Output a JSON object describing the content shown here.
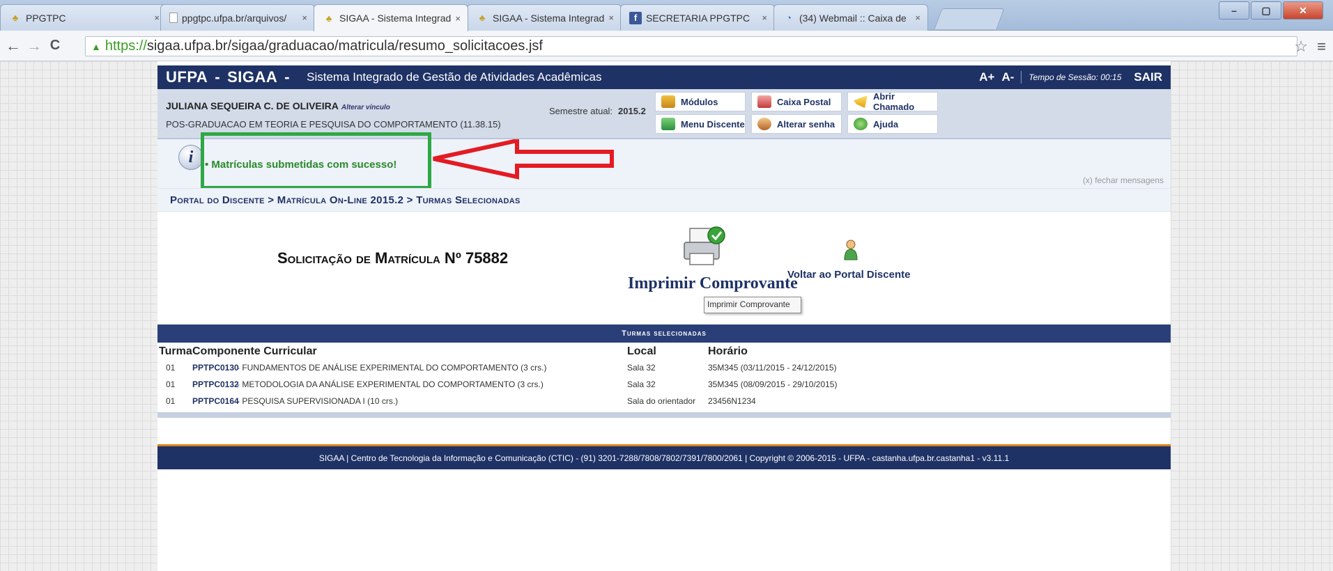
{
  "browser": {
    "tabs": [
      {
        "title": "PPGTPC",
        "icon": "ufpa-icon"
      },
      {
        "title": "ppgtpc.ufpa.br/arquivos/",
        "icon": "page-icon"
      },
      {
        "title": "SIGAA - Sistema Integrad",
        "icon": "ufpa-icon",
        "active": true
      },
      {
        "title": "SIGAA - Sistema Integrad",
        "icon": "ufpa-icon"
      },
      {
        "title": "SECRETARIA PPGTPC",
        "icon": "facebook-icon"
      },
      {
        "title": "(34) Webmail :: Caixa de",
        "icon": "webmail-icon"
      }
    ],
    "tab_close": "×",
    "url_scheme": "https://",
    "url_rest": "sigaa.ufpa.br/sigaa/graduacao/matricula/resumo_solicitacoes.jsf"
  },
  "header": {
    "brand_ufpa": "UFPA",
    "brand_sigaa": "SIGAA",
    "dash": "-",
    "system_name": "Sistema Integrado de Gestão de Atividades Acadêmicas",
    "font_up": "A+",
    "font_down": "A-",
    "session_label": "Tempo de Sessão: 00:15",
    "logout": "SAIR"
  },
  "user": {
    "name": "JULIANA SEQUEIRA C. DE OLIVEIRA",
    "alter_link": "Alterar vínculo",
    "program": "POS-GRADUACAO EM TEORIA E PESQUISA DO COMPORTAMENTO (11.38.15)",
    "semester_label": "Semestre atual:",
    "semester_value": "2015.2"
  },
  "quick": {
    "modulos": "Módulos",
    "caixa_postal": "Caixa Postal",
    "abrir_chamado": "Abrir Chamado",
    "menu_discente": "Menu Discente",
    "alterar_senha": "Alterar senha",
    "ajuda": "Ajuda"
  },
  "message": {
    "text": "Matrículas submetidas com sucesso!",
    "close": "(x) fechar mensagens",
    "highlight_color": "#2ea844",
    "arrow_color": "#e31b23"
  },
  "breadcrumb": "Portal do Discente > Matrícula On-Line 2015.2 > Turmas Selecionadas",
  "solicitacao": {
    "title": "Solicitação de Matrícula Nº 75882",
    "print_label": "Imprimir Comprovante",
    "tooltip": "Imprimir Comprovante",
    "back_label": "Voltar ao Portal Discente"
  },
  "table": {
    "caption": "Turmas selecionadas",
    "columns": {
      "turma": "Turma",
      "componente": "Componente Curricular",
      "local": "Local",
      "horario": "Horário"
    },
    "rows": [
      {
        "turma": "01",
        "codigo": "PPTPC0130",
        "nome": "- FUNDAMENTOS DE ANÁLISE EXPERIMENTAL DO COMPORTAMENTO (3 crs.)",
        "local": "Sala 32",
        "horario": "35M345 (03/11/2015 - 24/12/2015)"
      },
      {
        "turma": "01",
        "codigo": "PPTPC0132",
        "nome": "- METODOLOGIA DA ANÁLISE EXPERIMENTAL DO COMPORTAMENTO (3 crs.)",
        "local": "Sala 32",
        "horario": "35M345 (08/09/2015 - 29/10/2015)"
      },
      {
        "turma": "01",
        "codigo": "PPTPC0164",
        "nome": "- PESQUISA SUPERVISIONADA I (10 crs.)",
        "local": "Sala do orientador",
        "horario": "23456N1234"
      }
    ]
  },
  "footer": "SIGAA | Centro de Tecnologia da Informação e Comunicação (CTIC) - (91) 3201-7288/7808/7802/7391/7800/2061 | Copyright © 2006-2015 - UFPA - castanha.ufpa.br.castanha1 - v3.11.1"
}
